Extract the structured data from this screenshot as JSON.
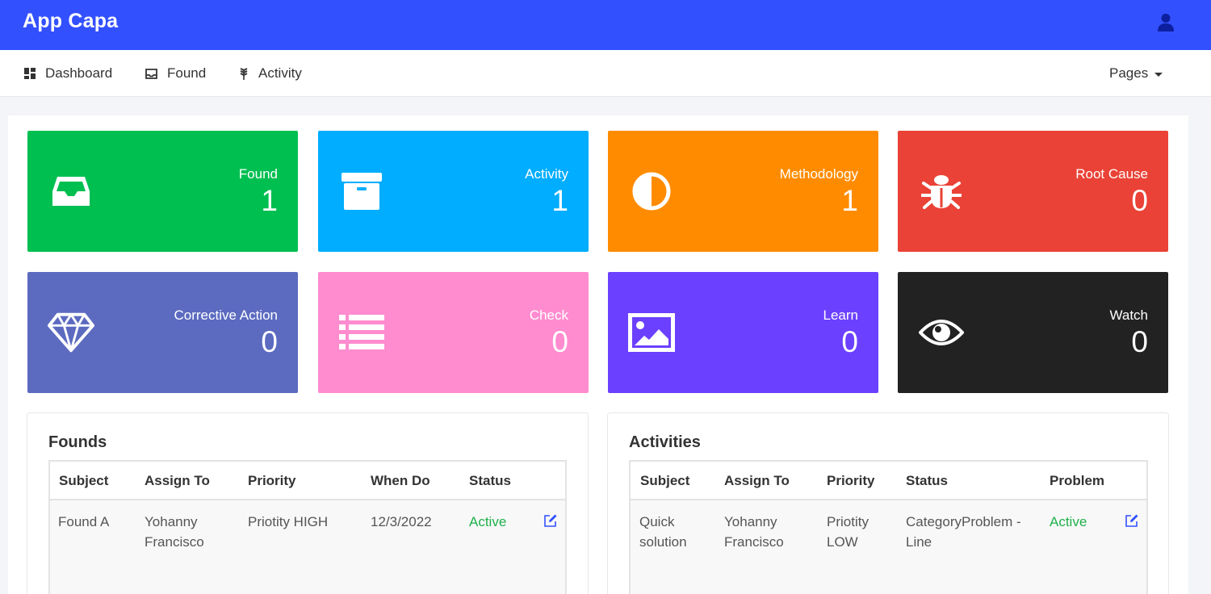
{
  "app": {
    "title": "App Capa"
  },
  "nav": {
    "items": [
      {
        "label": "Dashboard",
        "icon": "dashboard-icon"
      },
      {
        "label": "Found",
        "icon": "inbox-icon"
      },
      {
        "label": "Activity",
        "icon": "wheat-icon"
      }
    ],
    "pages_label": "Pages"
  },
  "cards": [
    {
      "label": "Found",
      "value": "1",
      "color": "#00bf51",
      "icon": "inbox-icon"
    },
    {
      "label": "Activity",
      "value": "1",
      "color": "#00adff",
      "icon": "archive-icon"
    },
    {
      "label": "Methodology",
      "value": "1",
      "color": "#ff8c00",
      "icon": "adjust-icon"
    },
    {
      "label": "Root Cause",
      "value": "0",
      "color": "#ea4236",
      "icon": "bug-icon"
    },
    {
      "label": "Corrective Action",
      "value": "0",
      "color": "#5c6bc0",
      "icon": "diamond-icon"
    },
    {
      "label": "Check",
      "value": "0",
      "color": "#ff8ccf",
      "icon": "list-icon"
    },
    {
      "label": "Learn",
      "value": "0",
      "color": "#6b40ff",
      "icon": "image-icon"
    },
    {
      "label": "Watch",
      "value": "0",
      "color": "#222222",
      "icon": "eye-icon"
    }
  ],
  "founds": {
    "title": "Founds",
    "columns": [
      "Subject",
      "Assign To",
      "Priority",
      "When Do",
      "Status"
    ],
    "rows": [
      {
        "subject": "Found A",
        "assign_to": "Yohanny Francisco",
        "priority": "Priotity HIGH",
        "when_do": "12/3/2022",
        "status": "Active"
      }
    ]
  },
  "activities": {
    "title": "Activities",
    "columns": [
      "Subject",
      "Assign To",
      "Priority",
      "Status",
      "Problem"
    ],
    "rows": [
      {
        "subject": "Quick solution",
        "assign_to": "Yohanny Francisco",
        "priority": "Priotity LOW",
        "status": "CategoryProblem - Line",
        "problem": "Active"
      }
    ]
  },
  "colors": {
    "primary": "#3350ff",
    "active": "#1fb04b",
    "edit": "#3350ff"
  }
}
